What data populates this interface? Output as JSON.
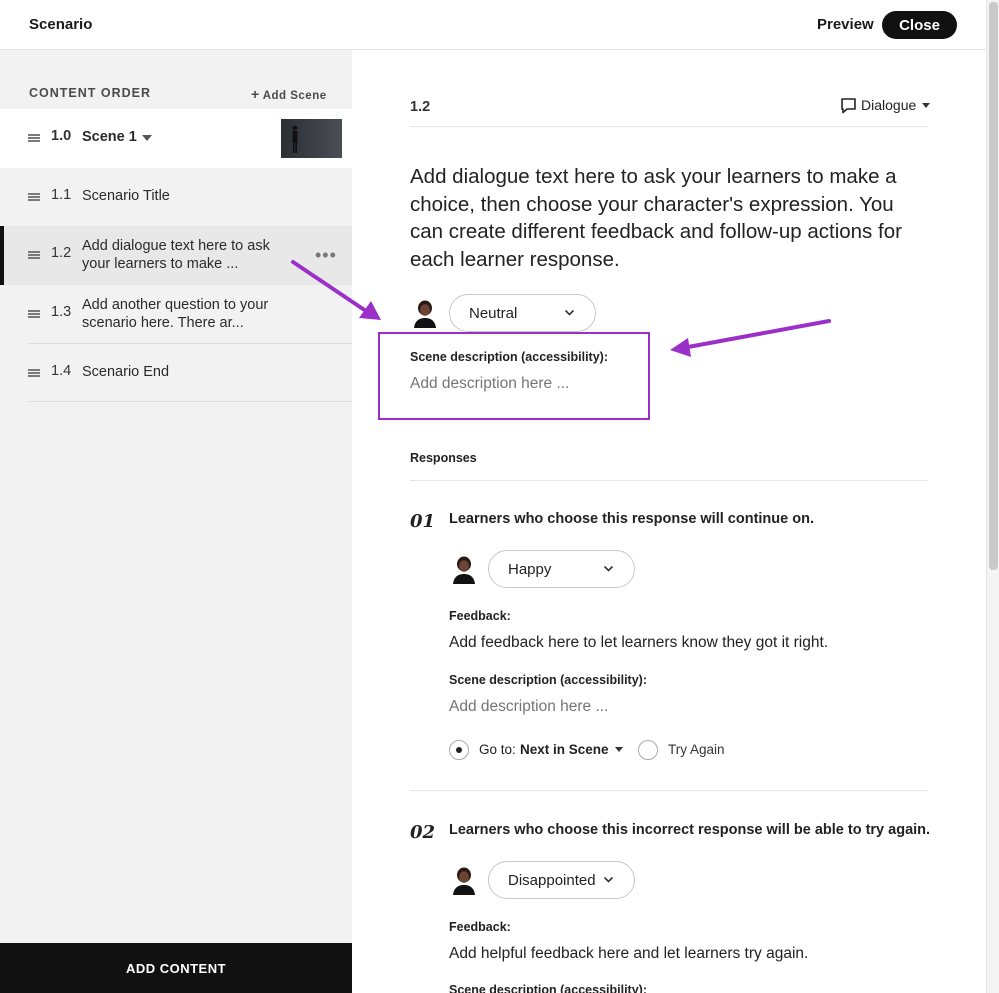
{
  "header": {
    "title": "Scenario",
    "preview_label": "Preview",
    "close_label": "Close"
  },
  "sidebar": {
    "section_title": "CONTENT ORDER",
    "add_scene_label": "Add Scene",
    "scene": {
      "number": "1.0",
      "label": "Scene 1"
    },
    "items": [
      {
        "number": "1.1",
        "label": "Scenario Title"
      },
      {
        "number": "1.2",
        "label": "Add dialogue text here to ask your learners to make ..."
      },
      {
        "number": "1.3",
        "label": "Add another question to your scenario here. There ar..."
      },
      {
        "number": "1.4",
        "label": "Scenario End"
      }
    ],
    "add_content_label": "ADD CONTENT"
  },
  "main": {
    "block_number": "1.2",
    "block_type": "Dialogue",
    "dialogue_text": "Add dialogue text here to ask your learners to make a choice, then choose your character's expression. You can create different feedback and follow-up actions for each learner response.",
    "expression": "Neutral",
    "scene_description_label": "Scene description (accessibility):",
    "scene_description_placeholder": "Add description here ...",
    "responses_title": "Responses",
    "responses": [
      {
        "number": "01",
        "text": "Learners who choose this response will continue on.",
        "expression": "Happy",
        "feedback_label": "Feedback:",
        "feedback_text": "Add feedback here to let learners know they got it right.",
        "scene_description_label": "Scene description (accessibility):",
        "scene_description_placeholder": "Add description here ...",
        "goto_label": "Go to:",
        "goto_value": "Next in Scene",
        "try_again_label": "Try Again"
      },
      {
        "number": "02",
        "text": "Learners who choose this incorrect response will be able to try again.",
        "expression": "Disappointed",
        "feedback_label": "Feedback:",
        "feedback_text": "Add helpful feedback here and let learners try again.",
        "scene_description_label": "Scene description (accessibility):"
      }
    ]
  },
  "annotation_color": "#9b30c9"
}
